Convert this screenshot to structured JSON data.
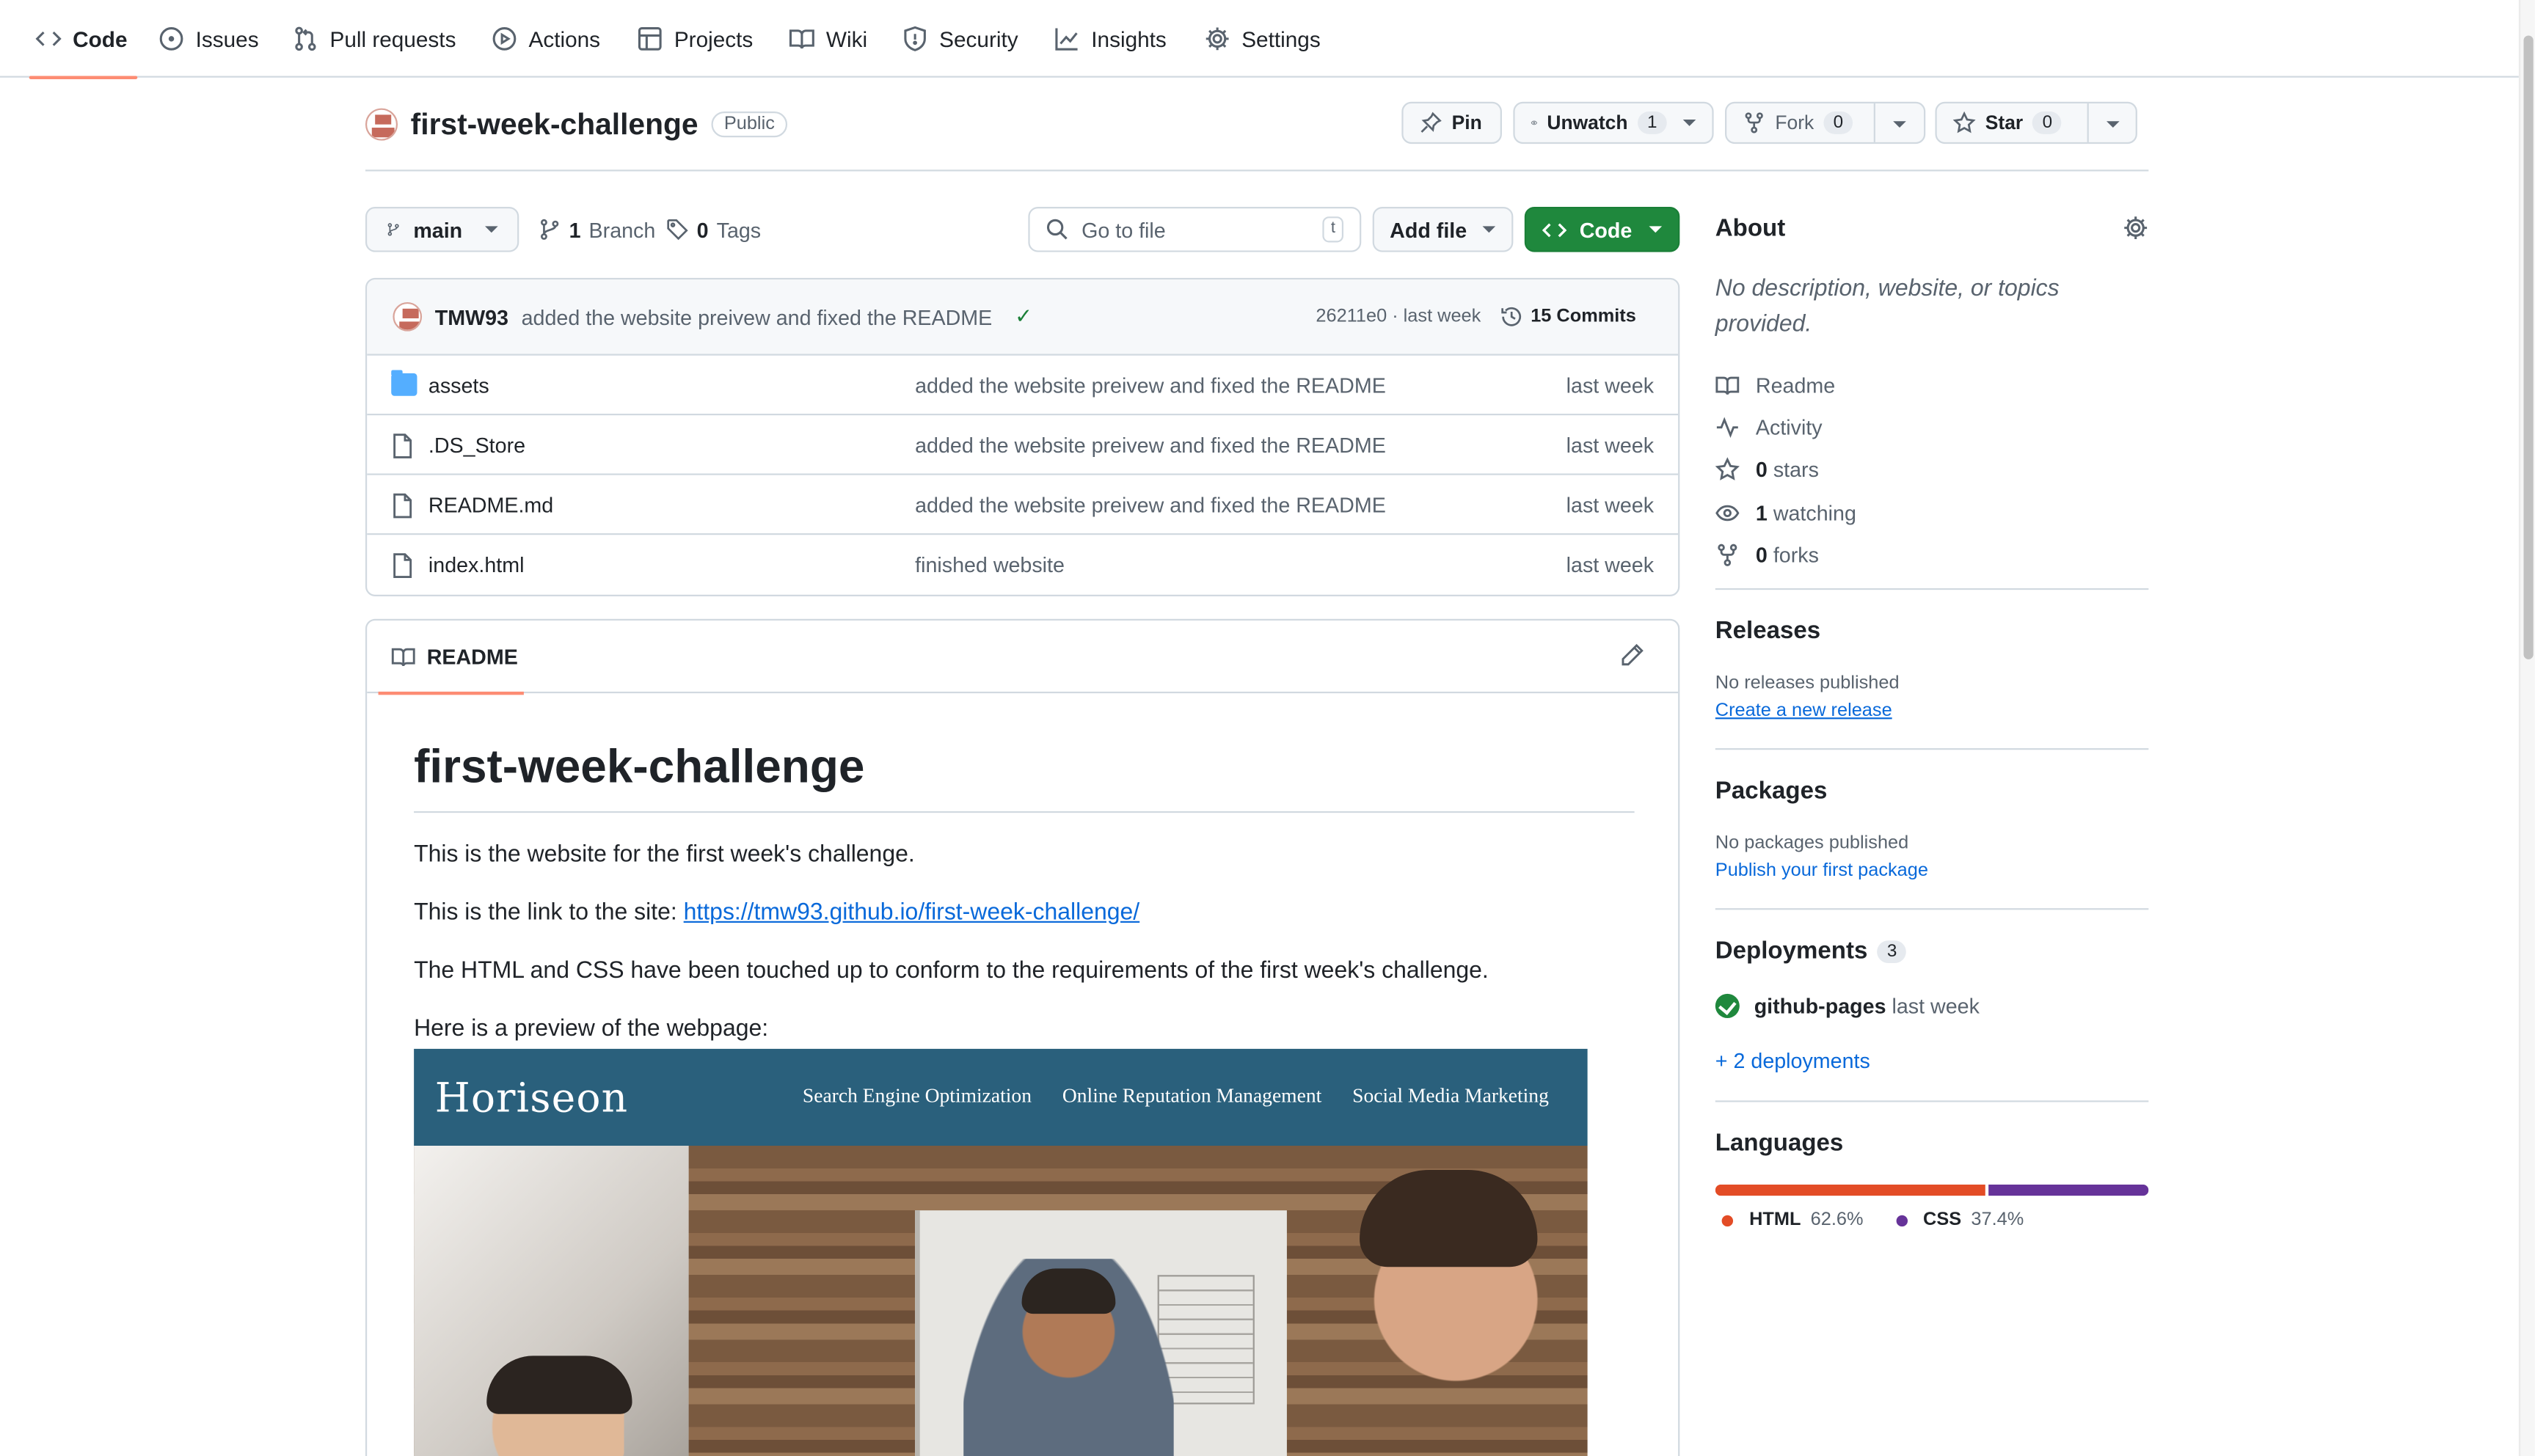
{
  "nav": {
    "tabs": [
      {
        "label": "Code",
        "icon": "code-icon"
      },
      {
        "label": "Issues",
        "icon": "issue-icon"
      },
      {
        "label": "Pull requests",
        "icon": "pull-request-icon"
      },
      {
        "label": "Actions",
        "icon": "play-icon"
      },
      {
        "label": "Projects",
        "icon": "table-icon"
      },
      {
        "label": "Wiki",
        "icon": "book-icon"
      },
      {
        "label": "Security",
        "icon": "shield-icon"
      },
      {
        "label": "Insights",
        "icon": "graph-icon"
      },
      {
        "label": "Settings",
        "icon": "gear-icon"
      }
    ]
  },
  "repo": {
    "name": "first-week-challenge",
    "visibility": "Public",
    "pin_label": "Pin",
    "unwatch_label": "Unwatch",
    "watch_count": "1",
    "fork_label": "Fork",
    "fork_count": "0",
    "star_label": "Star",
    "star_count": "0"
  },
  "toolbar": {
    "branch": "main",
    "branch_count": "1",
    "branch_label": "Branch",
    "tag_count": "0",
    "tag_label": "Tags",
    "search_placeholder": "Go to file",
    "search_shortcut": "t",
    "add_file_label": "Add file",
    "code_label": "Code"
  },
  "latest_commit": {
    "author": "TMW93",
    "message": "added the website preivew and fixed the README",
    "sha_time": "26211e0 · last week",
    "commits_label": "15 Commits"
  },
  "files": [
    {
      "name": "assets",
      "type": "folder",
      "message": "added the website preivew and fixed the README",
      "time": "last week"
    },
    {
      "name": ".DS_Store",
      "type": "file",
      "message": "added the website preivew and fixed the README",
      "time": "last week"
    },
    {
      "name": "README.md",
      "type": "file",
      "message": "added the website preivew and fixed the README",
      "time": "last week"
    },
    {
      "name": "index.html",
      "type": "file",
      "message": "finished website",
      "time": "last week"
    }
  ],
  "readme": {
    "tab_label": "README",
    "title": "first-week-challenge",
    "p1": "This is the website for the first week's challenge.",
    "p2_prefix": "This is the link to the site: ",
    "p2_link": "https://tmw93.github.io/first-week-challenge/",
    "p3": "The HTML and CSS have been touched up to conform to the requirements of the first week's challenge.",
    "p4": "Here is a preview of the webpage:",
    "preview": {
      "logo": "Horiseon",
      "links": [
        "Search Engine Optimization",
        "Online Reputation Management",
        "Social Media Marketing"
      ]
    }
  },
  "about": {
    "title": "About",
    "description": "No description, website, or topics provided.",
    "items": [
      {
        "num": "",
        "label": "Readme",
        "icon": "book-icon"
      },
      {
        "num": "",
        "label": "Activity",
        "icon": "pulse-icon"
      },
      {
        "num": "0",
        "label": "stars",
        "icon": "star-icon"
      },
      {
        "num": "1",
        "label": "watching",
        "icon": "eye-icon"
      },
      {
        "num": "0",
        "label": "forks",
        "icon": "fork-icon"
      }
    ]
  },
  "releases": {
    "title": "Releases",
    "empty": "No releases published",
    "link": "Create a new release"
  },
  "packages": {
    "title": "Packages",
    "empty": "No packages published",
    "link": "Publish your first package"
  },
  "deployments": {
    "title": "Deployments",
    "count": "3",
    "env": "github-pages",
    "time": "last week",
    "more": "+ 2 deployments"
  },
  "languages": {
    "title": "Languages",
    "items": [
      {
        "name": "HTML",
        "percent": "62.6%",
        "value": 62.6,
        "color": "#e34c26"
      },
      {
        "name": "CSS",
        "percent": "37.4%",
        "value": 37.4,
        "color": "#663399"
      }
    ]
  }
}
